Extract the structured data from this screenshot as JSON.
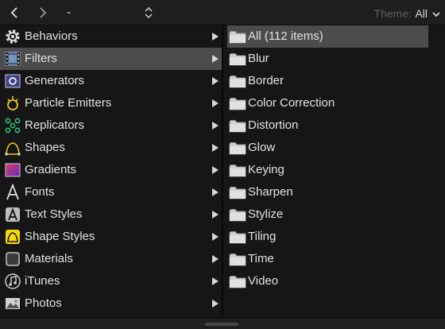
{
  "toolbar": {
    "path_label": "-",
    "theme_label": "Theme:",
    "theme_value": "All"
  },
  "categories": [
    {
      "label": "Behaviors",
      "icon": "gear-icon"
    },
    {
      "label": "Filters",
      "icon": "film-icon",
      "selected": true
    },
    {
      "label": "Generators",
      "icon": "generator-icon"
    },
    {
      "label": "Particle Emitters",
      "icon": "particle-emitter-icon"
    },
    {
      "label": "Replicators",
      "icon": "replicator-icon"
    },
    {
      "label": "Shapes",
      "icon": "shape-icon"
    },
    {
      "label": "Gradients",
      "icon": "gradient-icon"
    },
    {
      "label": "Fonts",
      "icon": "font-icon"
    },
    {
      "label": "Text Styles",
      "icon": "text-style-icon"
    },
    {
      "label": "Shape Styles",
      "icon": "shape-style-icon"
    },
    {
      "label": "Materials",
      "icon": "material-icon"
    },
    {
      "label": "iTunes",
      "icon": "music-note-icon"
    },
    {
      "label": "Photos",
      "icon": "photo-icon"
    }
  ],
  "items": [
    {
      "label": "All (112 items)",
      "selected": true
    },
    {
      "label": "Blur"
    },
    {
      "label": "Border"
    },
    {
      "label": "Color Correction"
    },
    {
      "label": "Distortion"
    },
    {
      "label": "Glow"
    },
    {
      "label": "Keying"
    },
    {
      "label": "Sharpen"
    },
    {
      "label": "Stylize"
    },
    {
      "label": "Tiling"
    },
    {
      "label": "Time"
    },
    {
      "label": "Video"
    }
  ],
  "colors": {
    "background": "#161616",
    "selection": "#4c4c4c",
    "text": "#e2e2e2",
    "muted_text": "#5e5e5e",
    "replicator_accent": "#2ecc71",
    "emitter_accent": "#f0c419",
    "shape_style_accent": "#f5d800"
  }
}
